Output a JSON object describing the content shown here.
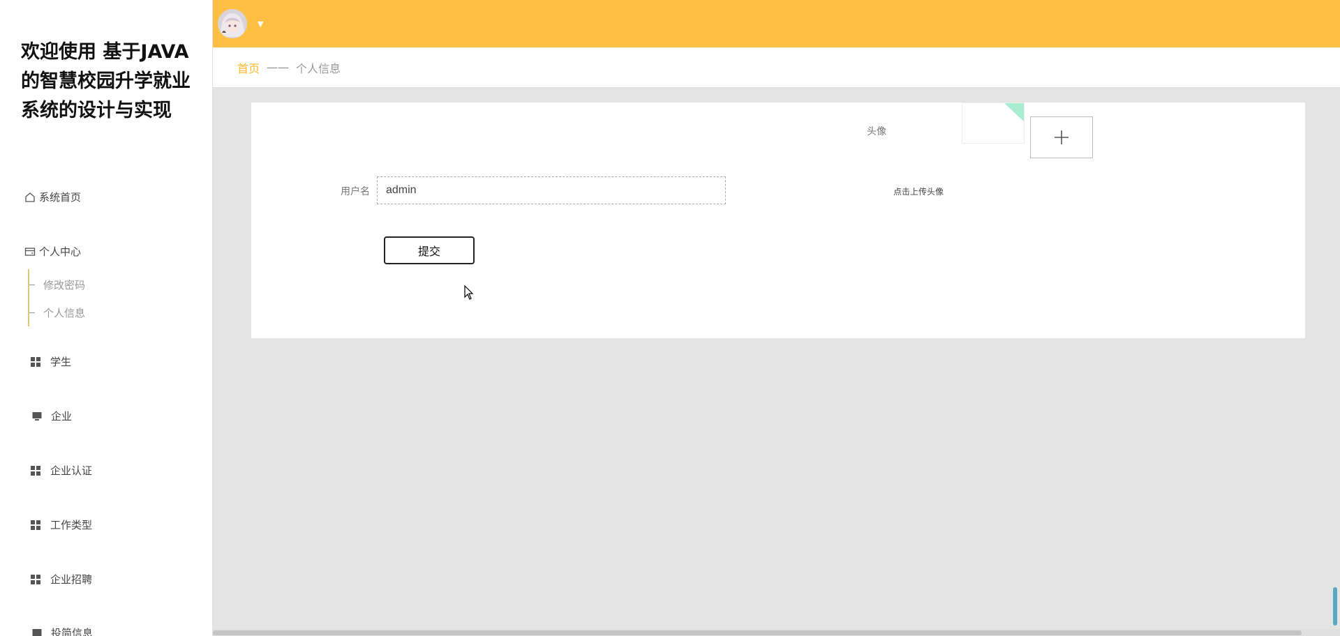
{
  "app": {
    "title": "欢迎使用 基于JAVA的智慧校园升学就业系统的设计与实现"
  },
  "sidebar": {
    "home": "系统首页",
    "personal_center": "个人中心",
    "sub_items": [
      "修改密码",
      "个人信息"
    ],
    "items": [
      "学生",
      "企业",
      "企业认证",
      "工作类型",
      "企业招聘",
      "投简信息"
    ]
  },
  "breadcrumb": {
    "home": "首页",
    "separator": "——",
    "current": "个人信息"
  },
  "form": {
    "avatar_label": "头像",
    "upload_tip": "点击上传头像",
    "username_label": "用户名",
    "username_value": "admin",
    "submit_label": "提交"
  },
  "colors": {
    "accent": "#ffbf44",
    "breadcrumb_active": "#ffb72e"
  }
}
